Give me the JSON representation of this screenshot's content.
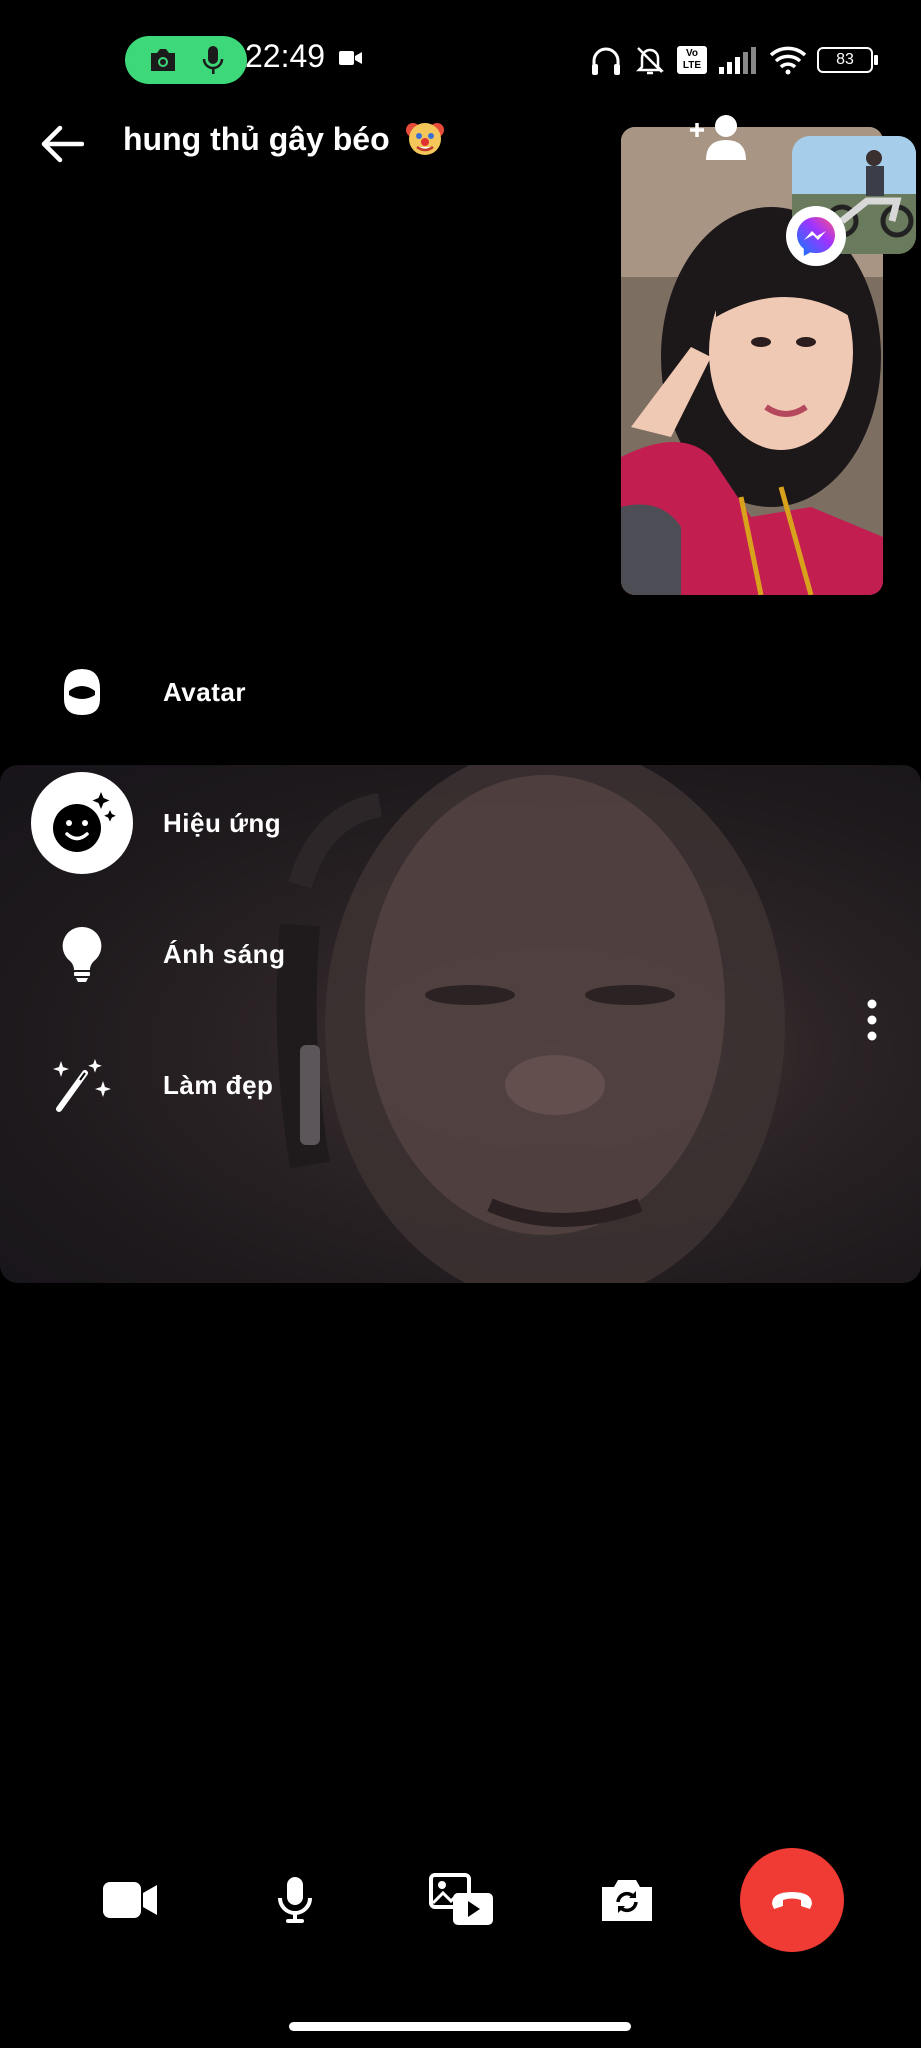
{
  "status_bar": {
    "time": "22:49",
    "battery": "83",
    "network_badge_top": "Vo",
    "network_badge_bottom": "LTE",
    "recording_pill_color": "#3dd87a"
  },
  "header": {
    "title": "hung thủ gây béo",
    "title_emoji": "clown-face-icon"
  },
  "effects_menu": {
    "items": [
      {
        "label": "Avatar",
        "icon": "avatar-face-icon"
      },
      {
        "label": "Hiệu ứng",
        "icon": "smiley-sparkle-icon",
        "selected": true
      },
      {
        "label": "Ánh sáng",
        "icon": "light-bulb-icon"
      },
      {
        "label": "Làm đẹp",
        "icon": "magic-wand-icon"
      }
    ]
  },
  "controls": {
    "buttons": [
      "video-camera-icon",
      "microphone-icon",
      "media-share-icon",
      "flip-camera-icon",
      "end-call-icon"
    ],
    "end_call_color": "#f03a34"
  }
}
